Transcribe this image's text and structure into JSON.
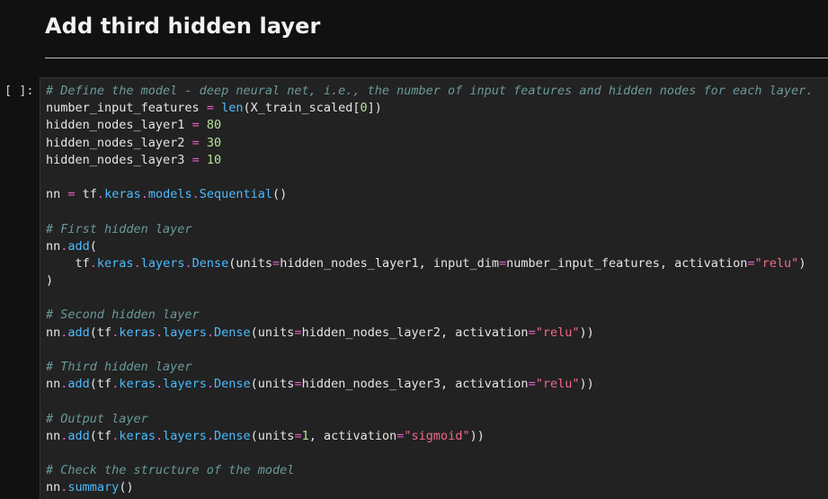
{
  "markdown": {
    "heading": "Add third hidden layer"
  },
  "cell": {
    "prompt": "[ ]:",
    "lines": [
      [
        {
          "t": "c",
          "v": "# Define the model - deep neural net, i.e., the number of input features and hidden nodes for each layer."
        }
      ],
      [
        {
          "t": "p",
          "v": "number_input_features "
        },
        {
          "t": "o",
          "v": "="
        },
        {
          "t": "p",
          "v": " "
        },
        {
          "t": "b",
          "v": "len"
        },
        {
          "t": "p",
          "v": "(X_train_scaled["
        },
        {
          "t": "n",
          "v": "0"
        },
        {
          "t": "p",
          "v": "])"
        }
      ],
      [
        {
          "t": "p",
          "v": "hidden_nodes_layer1 "
        },
        {
          "t": "o",
          "v": "="
        },
        {
          "t": "p",
          "v": " "
        },
        {
          "t": "n",
          "v": "80"
        }
      ],
      [
        {
          "t": "p",
          "v": "hidden_nodes_layer2 "
        },
        {
          "t": "o",
          "v": "="
        },
        {
          "t": "p",
          "v": " "
        },
        {
          "t": "n",
          "v": "30"
        }
      ],
      [
        {
          "t": "p",
          "v": "hidden_nodes_layer3 "
        },
        {
          "t": "o",
          "v": "="
        },
        {
          "t": "p",
          "v": " "
        },
        {
          "t": "n",
          "v": "10"
        }
      ],
      [],
      [
        {
          "t": "p",
          "v": "nn "
        },
        {
          "t": "o",
          "v": "="
        },
        {
          "t": "p",
          "v": " tf"
        },
        {
          "t": "o",
          "v": "."
        },
        {
          "t": "b",
          "v": "keras"
        },
        {
          "t": "o",
          "v": "."
        },
        {
          "t": "b",
          "v": "models"
        },
        {
          "t": "o",
          "v": "."
        },
        {
          "t": "b",
          "v": "Sequential"
        },
        {
          "t": "p",
          "v": "()"
        }
      ],
      [],
      [
        {
          "t": "c",
          "v": "# First hidden layer"
        }
      ],
      [
        {
          "t": "p",
          "v": "nn"
        },
        {
          "t": "o",
          "v": "."
        },
        {
          "t": "b",
          "v": "add"
        },
        {
          "t": "p",
          "v": "("
        }
      ],
      [
        {
          "t": "p",
          "v": "    tf"
        },
        {
          "t": "o",
          "v": "."
        },
        {
          "t": "b",
          "v": "keras"
        },
        {
          "t": "o",
          "v": "."
        },
        {
          "t": "b",
          "v": "layers"
        },
        {
          "t": "o",
          "v": "."
        },
        {
          "t": "b",
          "v": "Dense"
        },
        {
          "t": "p",
          "v": "(units"
        },
        {
          "t": "o",
          "v": "="
        },
        {
          "t": "p",
          "v": "hidden_nodes_layer1, input_dim"
        },
        {
          "t": "o",
          "v": "="
        },
        {
          "t": "p",
          "v": "number_input_features, activation"
        },
        {
          "t": "o",
          "v": "="
        },
        {
          "t": "s",
          "v": "\"relu\""
        },
        {
          "t": "p",
          "v": ")"
        }
      ],
      [
        {
          "t": "p",
          "v": ")"
        }
      ],
      [],
      [
        {
          "t": "c",
          "v": "# Second hidden layer"
        }
      ],
      [
        {
          "t": "p",
          "v": "nn"
        },
        {
          "t": "o",
          "v": "."
        },
        {
          "t": "b",
          "v": "add"
        },
        {
          "t": "p",
          "v": "(tf"
        },
        {
          "t": "o",
          "v": "."
        },
        {
          "t": "b",
          "v": "keras"
        },
        {
          "t": "o",
          "v": "."
        },
        {
          "t": "b",
          "v": "layers"
        },
        {
          "t": "o",
          "v": "."
        },
        {
          "t": "b",
          "v": "Dense"
        },
        {
          "t": "p",
          "v": "(units"
        },
        {
          "t": "o",
          "v": "="
        },
        {
          "t": "p",
          "v": "hidden_nodes_layer2, activation"
        },
        {
          "t": "o",
          "v": "="
        },
        {
          "t": "s",
          "v": "\"relu\""
        },
        {
          "t": "p",
          "v": "))"
        }
      ],
      [],
      [
        {
          "t": "c",
          "v": "# Third hidden layer"
        }
      ],
      [
        {
          "t": "p",
          "v": "nn"
        },
        {
          "t": "o",
          "v": "."
        },
        {
          "t": "b",
          "v": "add"
        },
        {
          "t": "p",
          "v": "(tf"
        },
        {
          "t": "o",
          "v": "."
        },
        {
          "t": "b",
          "v": "keras"
        },
        {
          "t": "o",
          "v": "."
        },
        {
          "t": "b",
          "v": "layers"
        },
        {
          "t": "o",
          "v": "."
        },
        {
          "t": "b",
          "v": "Dense"
        },
        {
          "t": "p",
          "v": "(units"
        },
        {
          "t": "o",
          "v": "="
        },
        {
          "t": "p",
          "v": "hidden_nodes_layer3, activation"
        },
        {
          "t": "o",
          "v": "="
        },
        {
          "t": "s",
          "v": "\"relu\""
        },
        {
          "t": "p",
          "v": "))"
        }
      ],
      [],
      [
        {
          "t": "c",
          "v": "# Output layer"
        }
      ],
      [
        {
          "t": "p",
          "v": "nn"
        },
        {
          "t": "o",
          "v": "."
        },
        {
          "t": "b",
          "v": "add"
        },
        {
          "t": "p",
          "v": "(tf"
        },
        {
          "t": "o",
          "v": "."
        },
        {
          "t": "b",
          "v": "keras"
        },
        {
          "t": "o",
          "v": "."
        },
        {
          "t": "b",
          "v": "layers"
        },
        {
          "t": "o",
          "v": "."
        },
        {
          "t": "b",
          "v": "Dense"
        },
        {
          "t": "p",
          "v": "(units"
        },
        {
          "t": "o",
          "v": "="
        },
        {
          "t": "n",
          "v": "1"
        },
        {
          "t": "p",
          "v": ", activation"
        },
        {
          "t": "o",
          "v": "="
        },
        {
          "t": "s",
          "v": "\"sigmoid\""
        },
        {
          "t": "p",
          "v": "))"
        }
      ],
      [],
      [
        {
          "t": "c",
          "v": "# Check the structure of the model"
        }
      ],
      [
        {
          "t": "p",
          "v": "nn"
        },
        {
          "t": "o",
          "v": "."
        },
        {
          "t": "b",
          "v": "summary"
        },
        {
          "t": "p",
          "v": "()"
        }
      ]
    ]
  },
  "colors": {
    "background": "#111111",
    "cell_background": "#222222",
    "comment": "#6a9a9a",
    "operator": "#e85fc3",
    "number": "#b5e29a",
    "string": "#f06a8a",
    "builtin": "#4bbbff",
    "plain": "#e6e6e6"
  }
}
